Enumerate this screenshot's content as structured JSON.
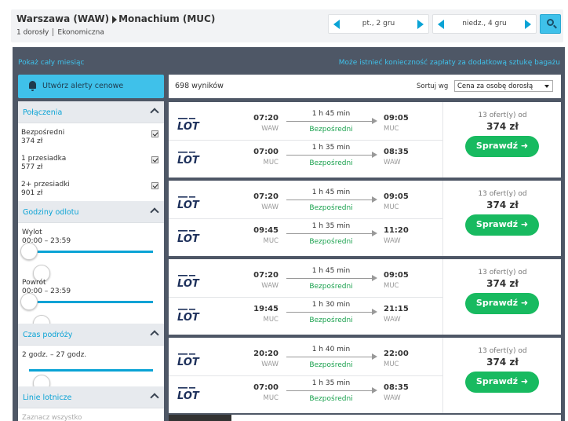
{
  "header": {
    "origin": "Warszawa (WAW)",
    "destination": "Monachium (MUC)",
    "passengers": "1 dorosły",
    "cabin": "Ekonomiczna",
    "depart_date": "pt., 2 gru",
    "return_date": "niedz., 4 gru"
  },
  "panel": {
    "show_month": "Pokaż cały miesiąc",
    "baggage_note": "Może istnieć konieczność zapłaty za dodatkową sztukę bagażu",
    "alert_button": "Utwórz alerty cenowe"
  },
  "filters": {
    "connections_title": "Połączenia",
    "connections": [
      {
        "label": "Bezpośredni",
        "price": "374 zł",
        "checked": true
      },
      {
        "label": "1 przesiadka",
        "price": "577 zł",
        "checked": true
      },
      {
        "label": "2+ przesiadki",
        "price": "901 zł",
        "checked": true
      }
    ],
    "times_title": "Godziny odlotu",
    "outbound_label": "Wylot",
    "outbound_range": "00:00 – 23:59",
    "return_label": "Powrót",
    "return_range": "00:00 – 23:59",
    "duration_title": "Czas podróży",
    "duration_range": "2 godz. – 27 godz.",
    "airlines_title": "Linie lotnicze",
    "select_all": "Zaznacz wszystko"
  },
  "results": {
    "count": "698 wyników",
    "sort_label": "Sortuj wg",
    "sort_value": "Cena za osobę dorosłą",
    "cards": [
      {
        "offers": "13 ofert(y) od",
        "price": "374 zł",
        "button": "Sprawdź ➜",
        "legs": [
          {
            "airline": "LOT",
            "dep": "07:20",
            "dep_code": "WAW",
            "duration": "1 h 45 min",
            "type": "Bezpośredni",
            "arr": "09:05",
            "arr_code": "MUC"
          },
          {
            "airline": "LOT",
            "dep": "07:00",
            "dep_code": "MUC",
            "duration": "1 h 35 min",
            "type": "Bezpośredni",
            "arr": "08:35",
            "arr_code": "WAW"
          }
        ]
      },
      {
        "offers": "13 ofert(y) od",
        "price": "374 zł",
        "button": "Sprawdź ➜",
        "legs": [
          {
            "airline": "LOT",
            "dep": "07:20",
            "dep_code": "WAW",
            "duration": "1 h 45 min",
            "type": "Bezpośredni",
            "arr": "09:05",
            "arr_code": "MUC"
          },
          {
            "airline": "LOT",
            "dep": "09:45",
            "dep_code": "MUC",
            "duration": "1 h 35 min",
            "type": "Bezpośredni",
            "arr": "11:20",
            "arr_code": "WAW"
          }
        ]
      },
      {
        "offers": "13 ofert(y) od",
        "price": "374 zł",
        "button": "Sprawdź ➜",
        "legs": [
          {
            "airline": "LOT",
            "dep": "07:20",
            "dep_code": "WAW",
            "duration": "1 h 45 min",
            "type": "Bezpośredni",
            "arr": "09:05",
            "arr_code": "MUC"
          },
          {
            "airline": "LOT",
            "dep": "19:45",
            "dep_code": "MUC",
            "duration": "1 h 30 min",
            "type": "Bezpośredni",
            "arr": "21:15",
            "arr_code": "WAW"
          }
        ]
      },
      {
        "offers": "13 ofert(y) od",
        "price": "374 zł",
        "button": "Sprawdź ➜",
        "legs": [
          {
            "airline": "LOT",
            "dep": "20:20",
            "dep_code": "WAW",
            "duration": "1 h 40 min",
            "type": "Bezpośredni",
            "arr": "22:00",
            "arr_code": "MUC"
          },
          {
            "airline": "LOT",
            "dep": "07:00",
            "dep_code": "MUC",
            "duration": "1 h 35 min",
            "type": "Bezpośredni",
            "arr": "08:35",
            "arr_code": "WAW"
          }
        ]
      }
    ]
  },
  "colors": {
    "accent": "#3fc1ea",
    "link": "#0aa3d5",
    "panel_bg": "#4e5766",
    "cta_green": "#18ba60",
    "direct_green": "#1aa14e",
    "lot_blue": "#1c2f5a"
  }
}
